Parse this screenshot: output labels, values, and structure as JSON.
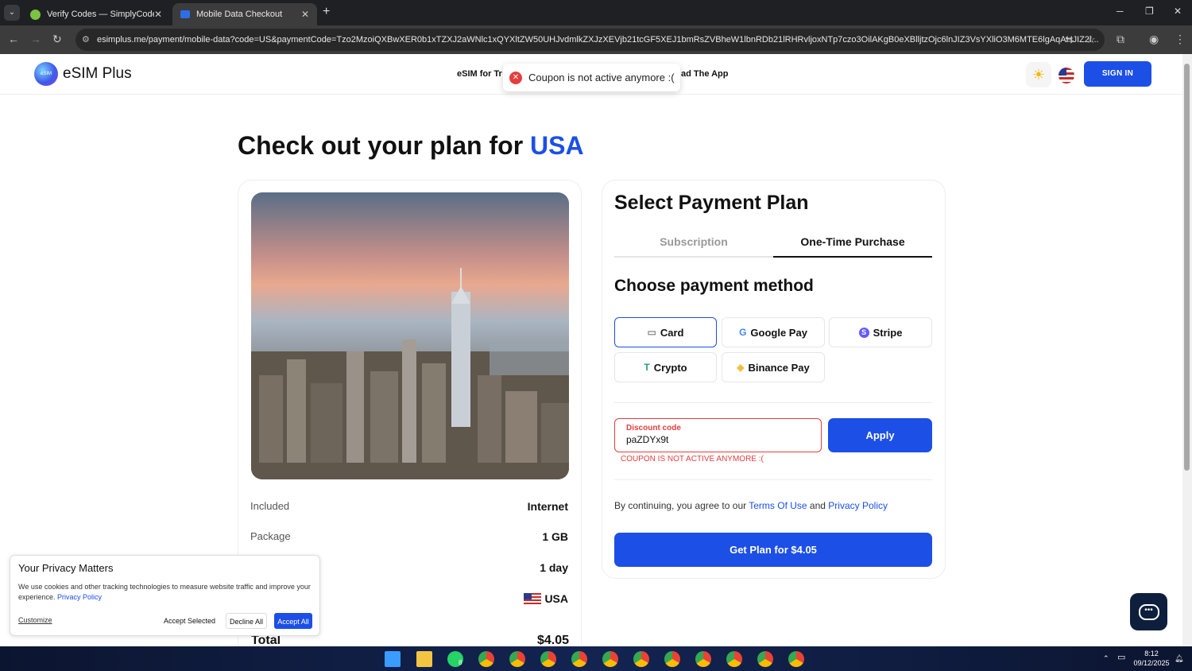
{
  "browser": {
    "tabs": [
      {
        "title": "Verify Codes — SimplyCodes"
      },
      {
        "title": "Mobile Data Checkout"
      }
    ],
    "url": "esimplus.me/payment/mobile-data?code=US&paymentCode=Tzo2MzoiQXBwXER0b1xTZXJ2aWNlc1xQYXltZW50UHJvdmlkZXJzXEVjb21tcGF5XEJ1bmRsZVBheW1lbnRDb21lRHRvljoxNTp7czo3OilAKgB0eXBlljtzOjc6lnJIZ3VsYXliO3M6MTE6lgAqAHJIZ2l..."
  },
  "header": {
    "logo_text": "eSIM Plus",
    "logo_mark": "eSIM",
    "nav_left": "eSIM for Tr",
    "nav_right": "ad The App",
    "sign_in": "SIGN IN"
  },
  "toast": {
    "message": "Coupon is not active anymore :("
  },
  "page": {
    "title_prefix": "Check out your plan for",
    "title_country": "USA"
  },
  "plan": {
    "rows": [
      {
        "label": "Included",
        "value": "Internet"
      },
      {
        "label": "Package",
        "value": "1 GB"
      },
      {
        "label": "",
        "value": "1 day"
      },
      {
        "label": "",
        "value": "USA"
      }
    ],
    "total_label": "Total",
    "total_value": "$4.05"
  },
  "payment": {
    "title": "Select Payment Plan",
    "tabs": [
      "Subscription",
      "One-Time Purchase"
    ],
    "active_tab": "One-Time Purchase",
    "method_title": "Choose payment method",
    "methods": [
      "Card",
      "Google Pay",
      "Stripe",
      "Crypto",
      "Binance Pay"
    ],
    "selected_method": "Card",
    "discount_label": "Discount code",
    "discount_value": "paZDYx9t",
    "discount_error": "COUPON IS NOT ACTIVE ANYMORE :(",
    "apply": "Apply",
    "agree_prefix": "By continuing, you agree to our",
    "terms": "Terms Of Use",
    "and": "and",
    "privacy": "Privacy Policy",
    "cta": "Get Plan for $4.05"
  },
  "privacy_banner": {
    "title": "Your Privacy Matters",
    "text": "We use cookies and other tracking technologies to measure website traffic and improve your experience.",
    "link": "Privacy Policy",
    "customize": "Customize",
    "accept_selected": "Accept Selected",
    "decline_all": "Decline All",
    "accept_all": "Accept All"
  },
  "taskbar": {
    "time": "8:12",
    "date": "09/12/2025",
    "badge": "8"
  },
  "colors": {
    "accent": "#1c4fe6",
    "error": "#e53e3e"
  }
}
